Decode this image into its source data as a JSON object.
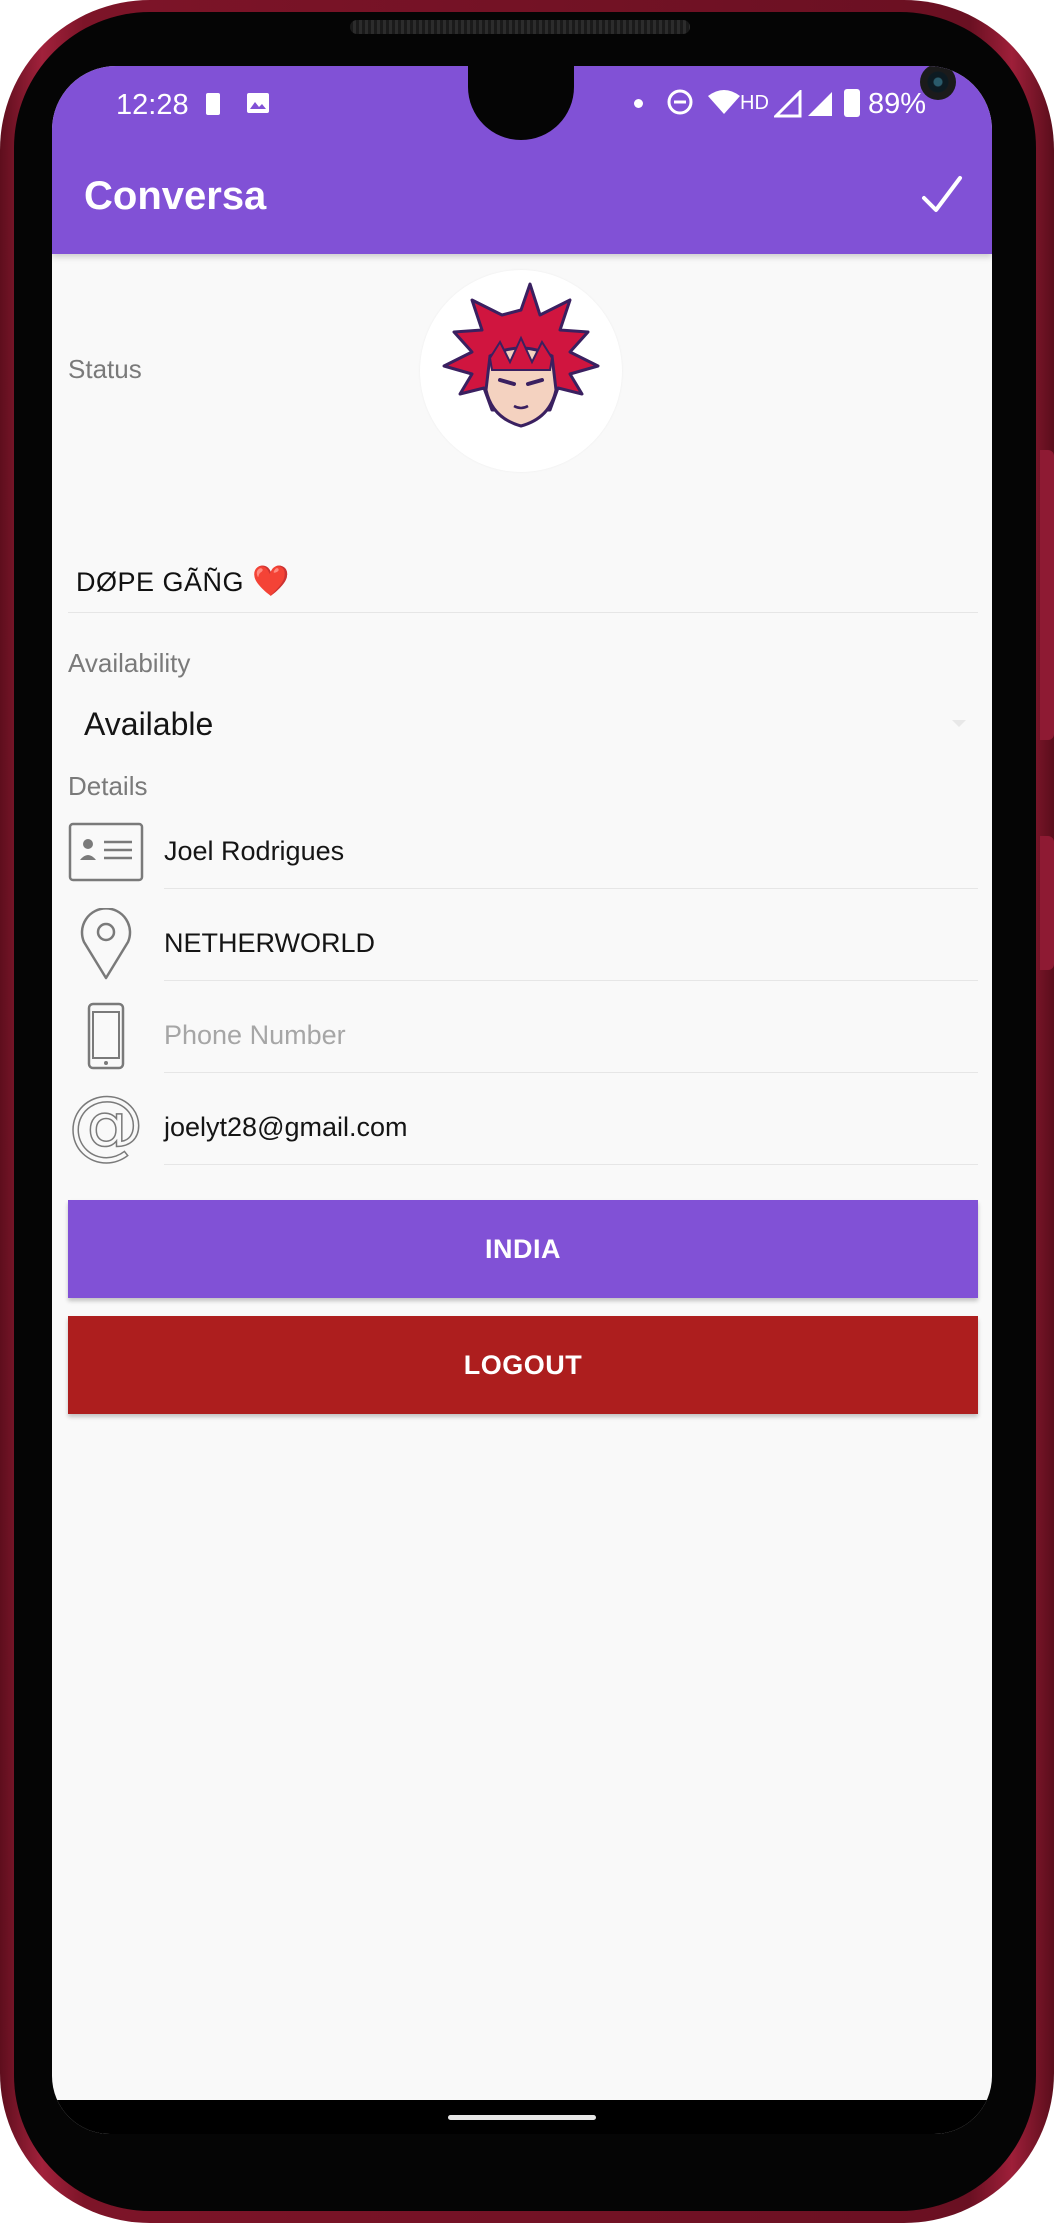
{
  "status_bar": {
    "time": "12:28",
    "network_label": "HD",
    "battery_percent": "89%"
  },
  "app_bar": {
    "title": "Conversa",
    "confirm_icon": "check-icon"
  },
  "profile": {
    "avatar_icon": "anime-avatar-red-hair"
  },
  "status": {
    "label": "Status",
    "value": "DØPE GÃÑG",
    "emoji": "❤️"
  },
  "availability": {
    "label": "Availability",
    "selected": "Available"
  },
  "details": {
    "label": "Details",
    "fields": [
      {
        "icon": "id-card-icon",
        "value": "Joel Rodrigues",
        "placeholder": ""
      },
      {
        "icon": "location-pin-icon",
        "value": "NETHERWORLD",
        "placeholder": ""
      },
      {
        "icon": "phone-icon",
        "value": "",
        "placeholder": "Phone Number"
      },
      {
        "icon": "at-sign-icon",
        "value": "joelyt28@gmail.com",
        "placeholder": ""
      }
    ]
  },
  "buttons": {
    "country": "INDIA",
    "logout": "LOGOUT"
  },
  "colors": {
    "primary": "#8151d6",
    "logout": "#ad1e1e",
    "background": "#f9f9f9",
    "phone_frame": "#7d1428"
  }
}
